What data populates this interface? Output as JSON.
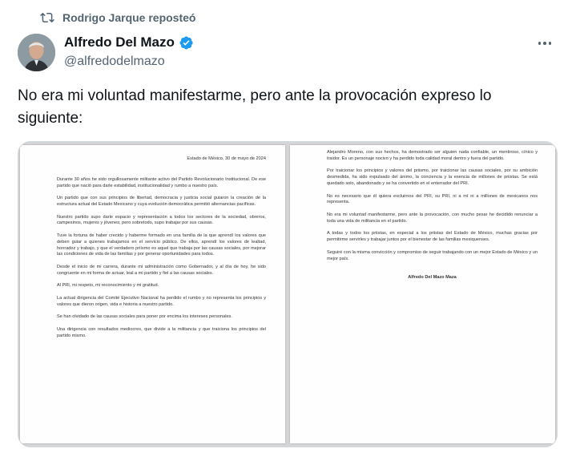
{
  "repost": {
    "label": "Rodrigo Jarque reposteó",
    "icon": "repost-icon"
  },
  "author": {
    "name": "Alfredo Del Mazo",
    "handle": "@alfredodelmazo",
    "verified_color": "#1d9bf0"
  },
  "tweet": {
    "text": "No era mi voluntad manifestarme, pero ante la provocación expreso lo siguiente:"
  },
  "document": {
    "date": "Estado de México, 30 de mayo de 2024",
    "page1": [
      "Durante 30 años he sido orgullosamente militante activo del Partido Revolucionario Institucional. De ese partido que nació para darle estabilidad, institucionalidad y rumbo a nuestro país.",
      "Un partido que con sus principios de libertad, democracia y justicia social guiaron la creación de la estructura actual del Estado Mexicano y cuya evolución democrática permitió alternancias pacíficas.",
      "Nuestro partido supo darle espacio y representación a todos los sectores de la sociedad, obreros, campesinos, mujeres y jóvenes; pero sobretodo, supo trabajar por sus causas.",
      "Tuve la fortuna de haber crecido y haberme formado en una familia de la que aprendí los valores que deben guiar a quienes trabajamos en el servicio público. De ellos, aprendí los valores de lealtad, honradez y trabajo, y que el verdadero priísmo es aquel que trabaja por las causas sociales, por mejorar las condiciones de vida de las familias y por generar oportunidades para todos.",
      "Desde el inicio de mi carrera, durante mi administración como Gobernador, y al día de hoy, he sido congruente en mi forma de actuar, leal a mi partido y fiel a las causas sociales.",
      "Al PRI, mi respeto, mi reconocimiento y mi gratitud.",
      "La actual dirigencia del Comité Ejecutivo Nacional ha perdido el rumbo y no representa los principios y valores que dieron origen, vida e historia a nuestro partido.",
      "Se han olvidado de las causas sociales para poner por encima los intereses personales.",
      "Una dirigencia con resultados mediocres, que divide a la militancia y que traiciona los principios del partido mismo."
    ],
    "page2": [
      "Alejandro Moreno, con sus hechos, ha demostrado ser alguien nada confiable, un mentiroso, cínico y traidor. Es un personaje nocivo y ha perdido toda calidad moral dentro y fuera del partido.",
      "Por traicionar los principios y valores del priismo, por traicionar las causas sociales, por su ambición desmedida, ha sido expulsado del ánimo, la conciencia y la esencia de millones de priistas. Se está quedado solo, abandonado y se ha convertido en el enterrador del PRI.",
      "No es necesario que él quiera excluirnos del PRI, su PRI, ni a mí ni a millones de mexicanos nos representa.",
      "No era mi voluntad manifestarme, pero ante la provocación, con mucho pesar he decidido renunciar a toda una vida de militancia en el partido.",
      "A todas y todos los priistas, en especial a los priistas del Estado de México, muchas gracias por permitirme servirles y trabajar juntos por el bienestar de las familias mexiquenses.",
      "Seguiré con la misma convicción y compromiso de seguir trabajando con un mejor Estado de México y un mejor país."
    ],
    "signature": "Alfredo Del Mazo Maza"
  }
}
